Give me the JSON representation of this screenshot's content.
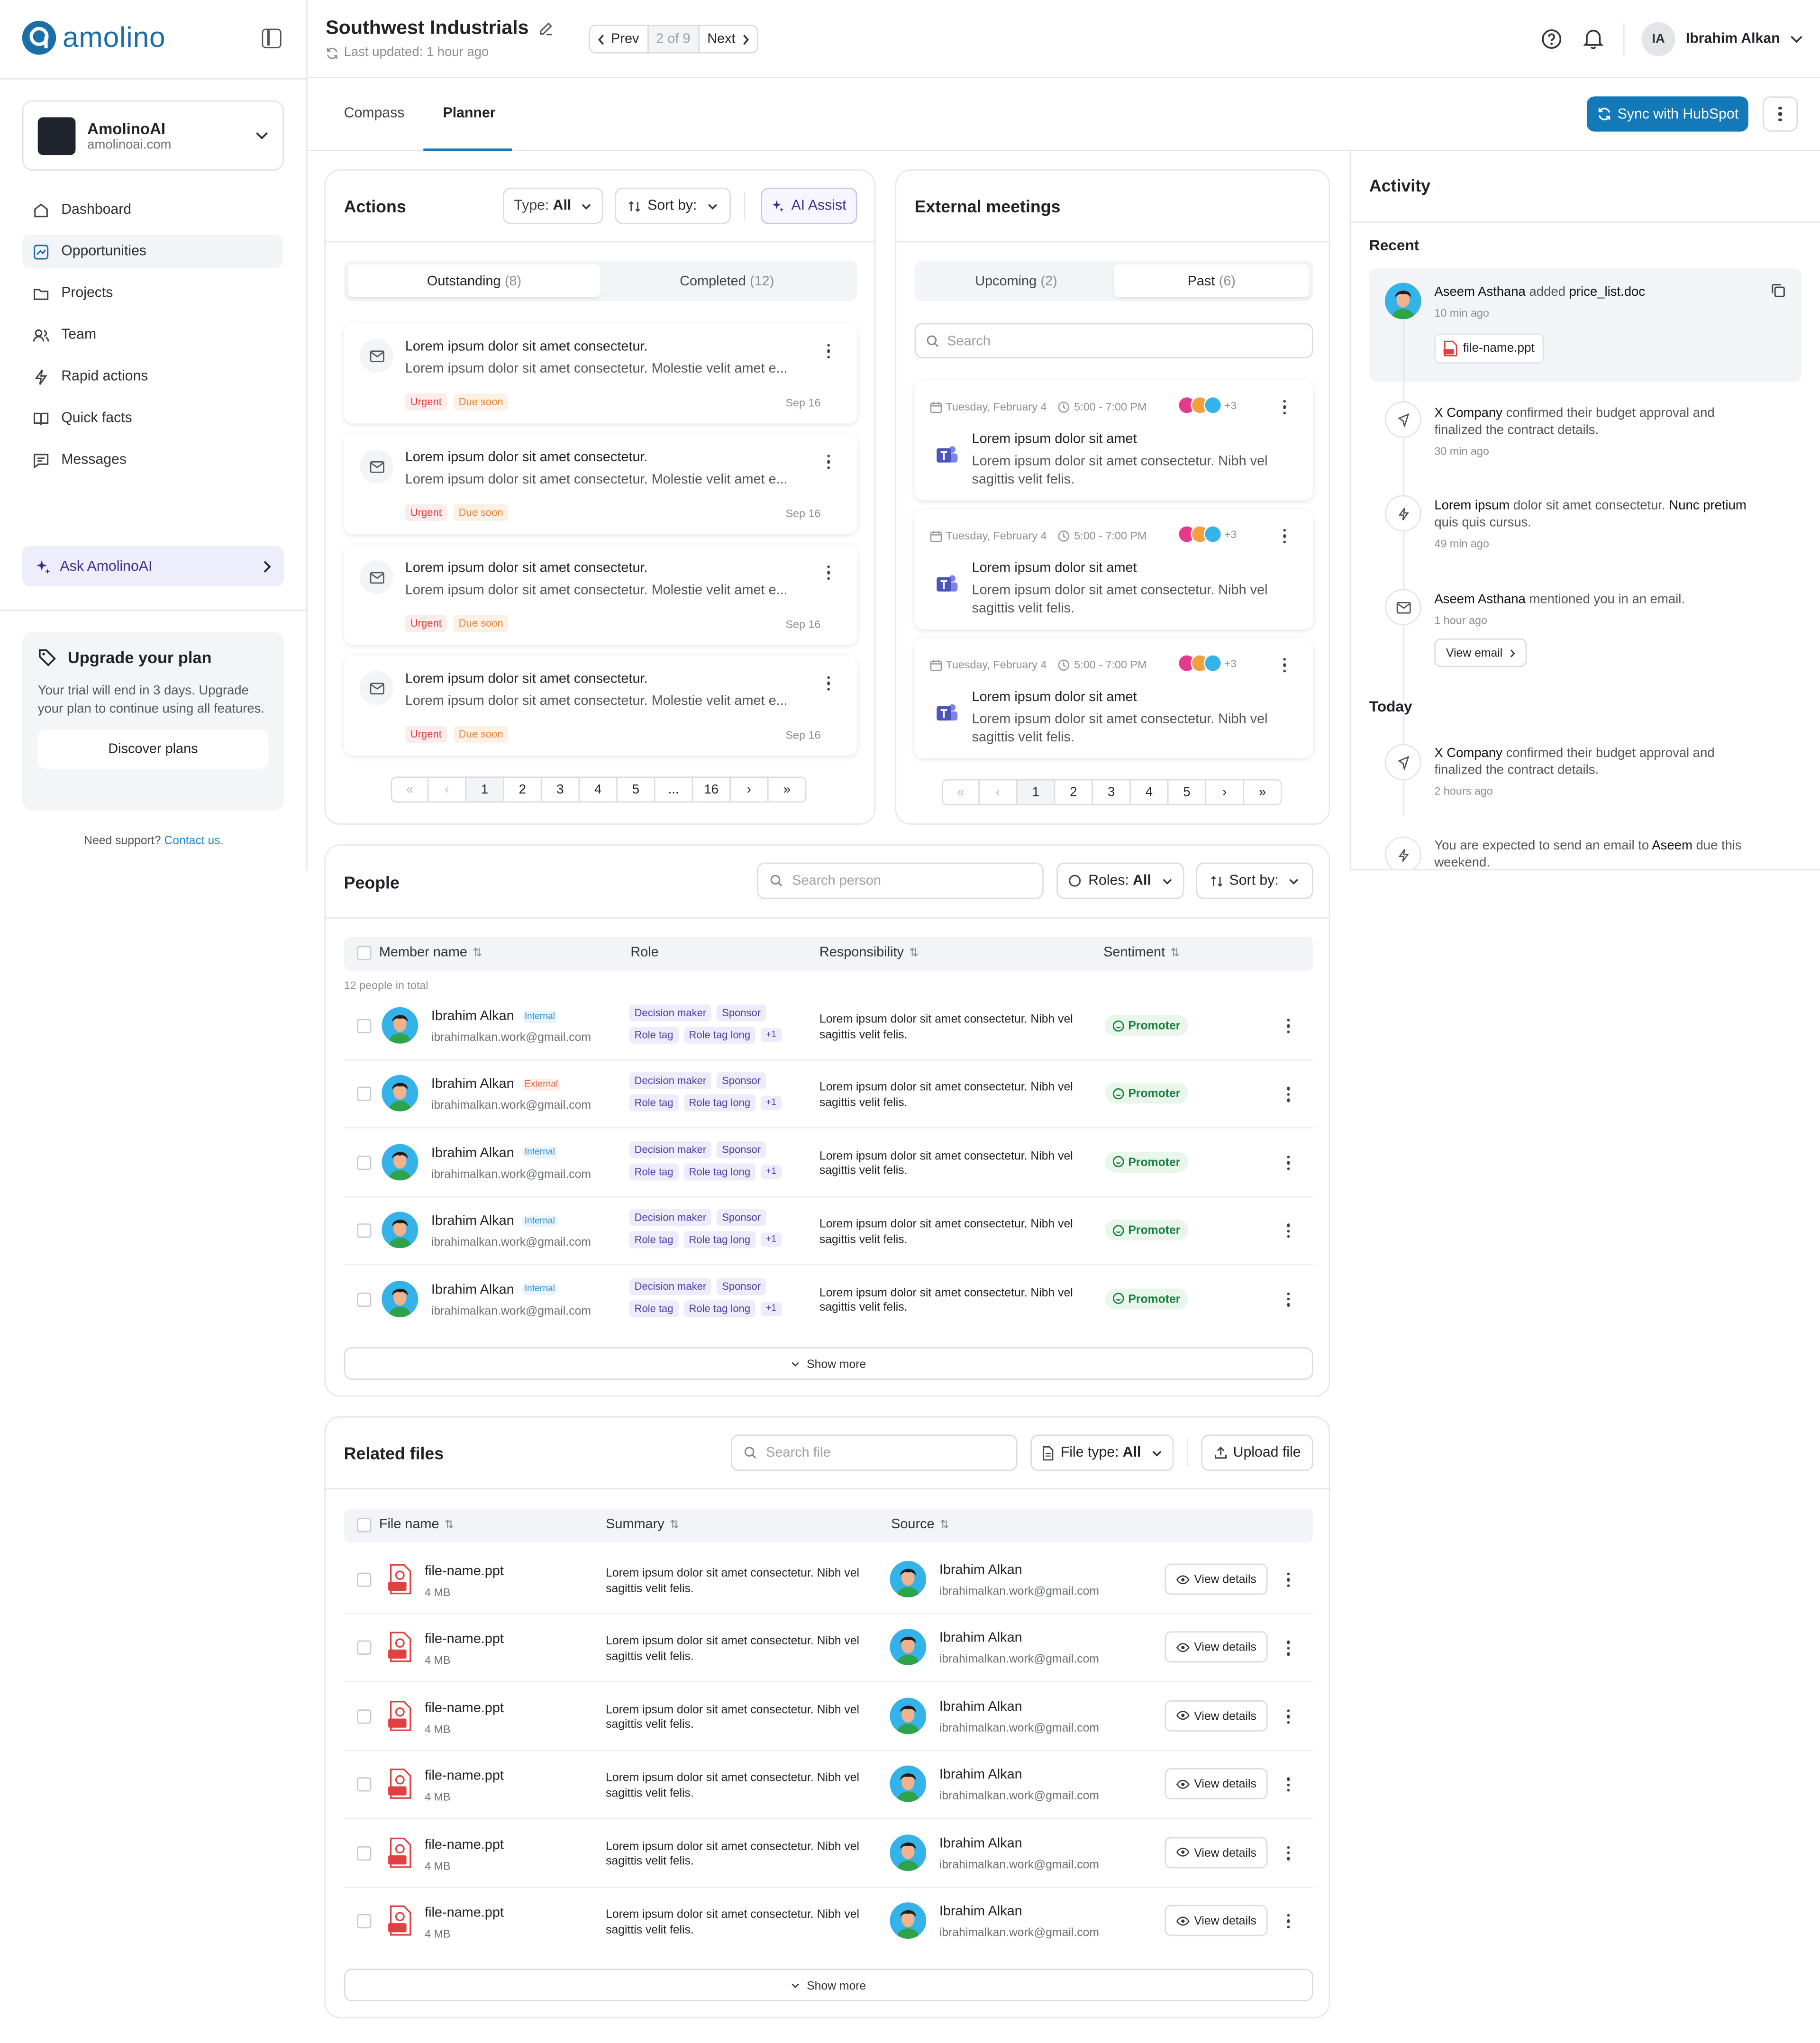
{
  "app": {
    "brand": "amolino"
  },
  "header": {
    "title": "Southwest Industrials",
    "last_updated": "Last updated: 1 hour ago",
    "prev": "Prev",
    "position": "2 of 9",
    "next": "Next",
    "user_initials": "IA",
    "user_name": "Ibrahim Alkan"
  },
  "workspace": {
    "name": "AmolinoAI",
    "domain": "amolinoai.com"
  },
  "sidebar": {
    "items": [
      {
        "label": "Dashboard",
        "icon": "home-icon"
      },
      {
        "label": "Opportunities",
        "icon": "chart-icon",
        "active": true
      },
      {
        "label": "Projects",
        "icon": "folder-icon"
      },
      {
        "label": "Team",
        "icon": "users-icon"
      },
      {
        "label": "Rapid actions",
        "icon": "bolt-icon"
      },
      {
        "label": "Quick facts",
        "icon": "book-icon"
      },
      {
        "label": "Messages",
        "icon": "message-icon"
      }
    ],
    "ask": "Ask AmolinoAI",
    "upgrade": {
      "title": "Upgrade your plan",
      "text": "Your trial will end in 3 days. Upgrade your plan to continue using all features.",
      "button": "Discover plans"
    },
    "support": "Need support?",
    "contact": "Contact us."
  },
  "tabs": {
    "compass": "Compass",
    "planner": "Planner",
    "sync": "Sync with HubSpot"
  },
  "actions": {
    "title": "Actions",
    "type_label": "Type:",
    "type_value": "All",
    "sort_label": "Sort by:",
    "ai_assist": "AI Assist",
    "tab_outstanding": "Outstanding",
    "outstanding_count": "(8)",
    "tab_completed": "Completed",
    "completed_count": "(12)",
    "items": [
      {
        "title": "Lorem ipsum dolor sit amet consectetur.",
        "desc": "Lorem ipsum dolor sit amet consectetur. Molestie velit amet e...",
        "tag1": "Urgent",
        "tag2": "Due soon",
        "date": "Sep 16"
      },
      {
        "title": "Lorem ipsum dolor sit amet consectetur.",
        "desc": "Lorem ipsum dolor sit amet consectetur. Molestie velit amet e...",
        "tag1": "Urgent",
        "tag2": "Due soon",
        "date": "Sep 16"
      },
      {
        "title": "Lorem ipsum dolor sit amet consectetur.",
        "desc": "Lorem ipsum dolor sit amet consectetur. Molestie velit amet e...",
        "tag1": "Urgent",
        "tag2": "Due soon",
        "date": "Sep 16"
      },
      {
        "title": "Lorem ipsum dolor sit amet consectetur.",
        "desc": "Lorem ipsum dolor sit amet consectetur. Molestie velit amet e...",
        "tag1": "Urgent",
        "tag2": "Due soon",
        "date": "Sep 16"
      }
    ],
    "pages": [
      "1",
      "2",
      "3",
      "4",
      "5",
      "...",
      "16"
    ]
  },
  "meetings": {
    "title": "External meetings",
    "tab_upcoming": "Upcoming",
    "upcoming_count": "(2)",
    "tab_past": "Past",
    "past_count": "(6)",
    "search_placeholder": "Search",
    "items": [
      {
        "date": "Tuesday, February 4",
        "time": "5:00 - 7:00 PM",
        "extra": "+3",
        "title": "Lorem ipsum dolor sit amet",
        "desc": "Lorem ipsum dolor sit amet consectetur. Nibh vel sagittis velit felis."
      },
      {
        "date": "Tuesday, February 4",
        "time": "5:00 - 7:00 PM",
        "extra": "+3",
        "title": "Lorem ipsum dolor sit amet",
        "desc": "Lorem ipsum dolor sit amet consectetur. Nibh vel sagittis velit felis."
      },
      {
        "date": "Tuesday, February 4",
        "time": "5:00 - 7:00 PM",
        "extra": "+3",
        "title": "Lorem ipsum dolor sit amet",
        "desc": "Lorem ipsum dolor sit amet consectetur. Nibh vel sagittis velit felis."
      }
    ],
    "pages": [
      "1",
      "2",
      "3",
      "4",
      "5"
    ]
  },
  "activity": {
    "title": "Activity",
    "recent": "Recent",
    "today": "Today",
    "items": [
      {
        "who": "Aseem Asthana",
        "mid": " added ",
        "what": "price_list.doc",
        "time": "10 min ago",
        "file": "file-name.ppt"
      },
      {
        "who": "X Company",
        "mid": " confirmed their budget approval and finalized the contract details.",
        "time": "30 min ago"
      },
      {
        "who": "Lorem ipsum",
        "mid": " dolor sit amet consectetur. ",
        "what": "Nunc pretium",
        "tail": " quis quis cursus.",
        "time": "49 min ago"
      },
      {
        "who": "Aseem Asthana",
        "mid": " mentioned you in an email.",
        "time": "1 hour ago",
        "button": "View email"
      },
      {
        "who": "X Company",
        "mid": " confirmed their budget approval and finalized the contract details.",
        "time": "2 hours ago"
      },
      {
        "pre": "You are expected to send an email to ",
        "who": "Aseem",
        "mid": " due this weekend."
      }
    ]
  },
  "people": {
    "title": "People",
    "search_placeholder": "Search person",
    "roles_label": "Roles:",
    "roles_value": "All",
    "sort_label": "Sort by:",
    "col_member": "Member name",
    "col_role": "Role",
    "col_resp": "Responsibility",
    "col_sentiment": "Sentiment",
    "total": "12 people in total",
    "rows": [
      {
        "name": "Ibrahim Alkan",
        "badge": "Internal",
        "email": "ibrahimalkan.work@gmail.com",
        "roles": [
          "Decision maker",
          "Sponsor"
        ],
        "roles2": [
          "Role tag",
          "Role tag long",
          "+1"
        ],
        "resp": "Lorem ipsum dolor sit amet consectetur. Nibh vel sagittis velit felis.",
        "sentiment": "Promoter"
      },
      {
        "name": "Ibrahim Alkan",
        "badge": "External",
        "email": "ibrahimalkan.work@gmail.com",
        "roles": [
          "Decision maker",
          "Sponsor"
        ],
        "roles2": [
          "Role tag",
          "Role tag long",
          "+1"
        ],
        "resp": "Lorem ipsum dolor sit amet consectetur. Nibh vel sagittis velit felis.",
        "sentiment": "Promoter"
      },
      {
        "name": "Ibrahim Alkan",
        "badge": "Internal",
        "email": "ibrahimalkan.work@gmail.com",
        "roles": [
          "Decision maker",
          "Sponsor"
        ],
        "roles2": [
          "Role tag",
          "Role tag long",
          "+1"
        ],
        "resp": "Lorem ipsum dolor sit amet consectetur. Nibh vel sagittis velit felis.",
        "sentiment": "Promoter"
      },
      {
        "name": "Ibrahim Alkan",
        "badge": "Internal",
        "email": "ibrahimalkan.work@gmail.com",
        "roles": [
          "Decision maker",
          "Sponsor"
        ],
        "roles2": [
          "Role tag",
          "Role tag long",
          "+1"
        ],
        "resp": "Lorem ipsum dolor sit amet consectetur. Nibh vel sagittis velit felis.",
        "sentiment": "Promoter"
      },
      {
        "name": "Ibrahim Alkan",
        "badge": "Internal",
        "email": "ibrahimalkan.work@gmail.com",
        "roles": [
          "Decision maker",
          "Sponsor"
        ],
        "roles2": [
          "Role tag",
          "Role tag long",
          "+1"
        ],
        "resp": "Lorem ipsum dolor sit amet consectetur. Nibh vel sagittis velit felis.",
        "sentiment": "Promoter"
      }
    ],
    "show_more": "Show more"
  },
  "files": {
    "title": "Related files",
    "search_placeholder": "Search file",
    "type_label": "File type:",
    "type_value": "All",
    "upload": "Upload file",
    "col_name": "File name",
    "col_summary": "Summary",
    "col_source": "Source",
    "rows": [
      {
        "name": "file-name.ppt",
        "size": "4 MB",
        "summary": "Lorem ipsum dolor sit amet consectetur. Nibh vel sagittis velit felis.",
        "person": "Ibrahim Alkan",
        "email": "ibrahimalkan.work@gmail.com",
        "action": "View details"
      },
      {
        "name": "file-name.ppt",
        "size": "4 MB",
        "summary": "Lorem ipsum dolor sit amet consectetur. Nibh vel sagittis velit felis.",
        "person": "Ibrahim Alkan",
        "email": "ibrahimalkan.work@gmail.com",
        "action": "View details"
      },
      {
        "name": "file-name.ppt",
        "size": "4 MB",
        "summary": "Lorem ipsum dolor sit amet consectetur. Nibh vel sagittis velit felis.",
        "person": "Ibrahim Alkan",
        "email": "ibrahimalkan.work@gmail.com",
        "action": "View details"
      },
      {
        "name": "file-name.ppt",
        "size": "4 MB",
        "summary": "Lorem ipsum dolor sit amet consectetur. Nibh vel sagittis velit felis.",
        "person": "Ibrahim Alkan",
        "email": "ibrahimalkan.work@gmail.com",
        "action": "View details"
      },
      {
        "name": "file-name.ppt",
        "size": "4 MB",
        "summary": "Lorem ipsum dolor sit amet consectetur. Nibh vel sagittis velit felis.",
        "person": "Ibrahim Alkan",
        "email": "ibrahimalkan.work@gmail.com",
        "action": "View details"
      },
      {
        "name": "file-name.ppt",
        "size": "4 MB",
        "summary": "Lorem ipsum dolor sit amet consectetur. Nibh vel sagittis velit felis.",
        "person": "Ibrahim Alkan",
        "email": "ibrahimalkan.work@gmail.com",
        "action": "View details"
      }
    ],
    "show_more": "Show more"
  },
  "colors": {
    "brand": "#1a6fa8",
    "primary_button": "#1479b8",
    "urgent": "#e04040",
    "due_soon": "#e8863a",
    "promoter": "#1a7f3c"
  }
}
